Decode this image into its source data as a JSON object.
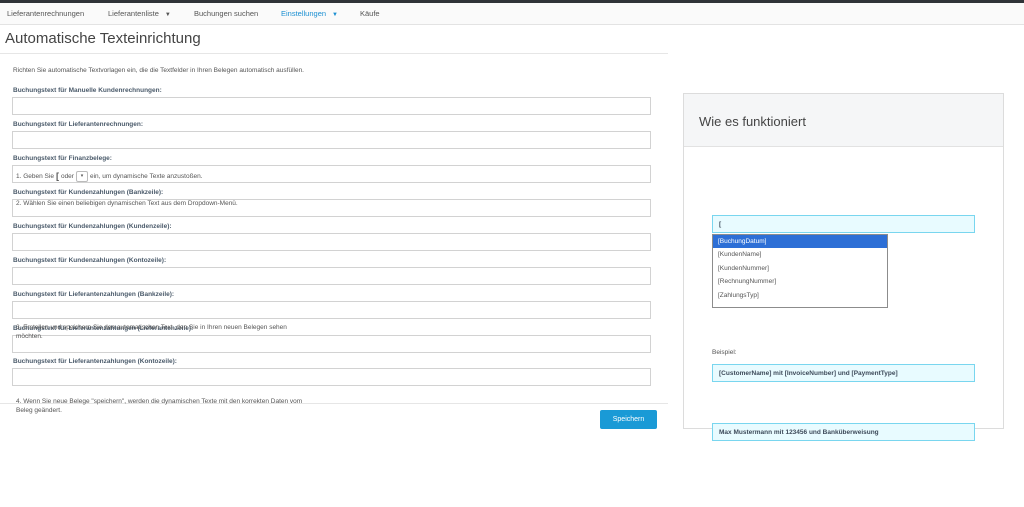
{
  "nav": {
    "items": [
      {
        "label": "Lieferantenrechnungen",
        "dropdown": false,
        "active": false
      },
      {
        "label": "Lieferantenliste",
        "dropdown": true,
        "active": false
      },
      {
        "label": "Buchungen suchen",
        "dropdown": false,
        "active": false
      },
      {
        "label": "Einstellungen",
        "dropdown": true,
        "active": true
      },
      {
        "label": "Käufe",
        "dropdown": false,
        "active": false
      }
    ],
    "caret": "▼"
  },
  "page": {
    "title": "Automatische Texteinrichtung",
    "intro": "Richten Sie automatische Textvorlagen ein, die die Textfelder in Ihren Belegen automatisch ausfüllen."
  },
  "form": {
    "fields": [
      {
        "label": "Buchungstext für Manuelle Kundenrechnungen:",
        "value": ""
      },
      {
        "label": "Buchungstext für Lieferantenrechnungen:",
        "value": ""
      },
      {
        "label": "Buchungstext für Finanzbelege:",
        "value": ""
      },
      {
        "label": "Buchungstext für Kundenzahlungen (Bankzeile):",
        "value": ""
      },
      {
        "label": "Buchungstext für Kundenzahlungen (Kundenzeile):",
        "value": ""
      },
      {
        "label": "Buchungstext für Kundenzahlungen (Kontozeile):",
        "value": ""
      },
      {
        "label": "Buchungstext für Lieferantenzahlungen (Bankzeile):",
        "value": ""
      },
      {
        "label": "Buchungstext für Lieferantenzahlungen (Lieferantenzeile):",
        "value": ""
      },
      {
        "label": "Buchungstext für Lieferantenzahlungen (Kontozeile):",
        "value": ""
      }
    ],
    "save_label": "Speichern"
  },
  "help": {
    "title": "Wie es funktioniert",
    "step1": {
      "before": "1. Geben Sie",
      "bracket": "[",
      "oder": "oder",
      "dropdown_glyph": "▾",
      "after": "ein, um dynamische Texte anzustoßen."
    },
    "step2": "2. Wählen Sie einen beliebigen dynamischen Text aus dem Dropdown-Menü.",
    "step2_input": "[",
    "dropdown_options": [
      "[BuchungDatum]",
      "[KundenName]",
      "[KundenNummer]",
      "[RechnungNummer]",
      "[ZahlungsTyp]"
    ],
    "selected_option_index": 0,
    "step3": "3. Erstellen und speichern Sie den automatischen Text, den Sie in Ihren neuen Belegen sehen möchten.",
    "example_label": "Beispiel:",
    "example_value": "[CustomerName] mit [InvoiceNumber] und [PaymentType]",
    "step4": "4. Wenn Sie neue Belege \"speichern\", werden die dynamischen Texte mit den korrekten Daten vom Beleg geändert.",
    "result_value": "Max Mustermann mit 123456 und Banküberweisung"
  },
  "colors": {
    "accent": "#1a9ad6",
    "active_nav": "#1a8fd2",
    "highlight_bg": "#e8fbff",
    "highlight_border": "#79d6ef",
    "selected_option": "#2d6fd6"
  }
}
